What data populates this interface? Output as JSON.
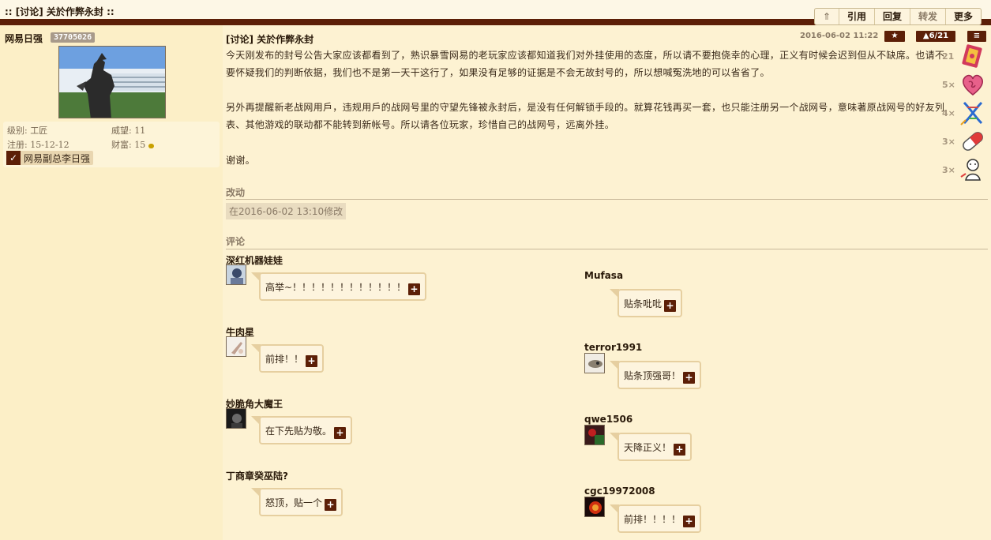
{
  "window": {
    "title": ":: [讨论] 关於作弊永封 ::"
  },
  "toolbar": {
    "top_label": "⇑",
    "quote_label": "引用",
    "reply_label": "回复",
    "forward_label": "转发",
    "more_label": "更多"
  },
  "author": {
    "name": "网易日强",
    "uid": "37705026",
    "level_label": "级别: 工匠",
    "prestige_label": "威望: 11",
    "registered_label": "注册: 15-12-12",
    "wealth_label": "财富: 15",
    "badge_title": "网易副总李日强"
  },
  "post": {
    "title": "[讨论] 关於作弊永封",
    "date": "2016-06-02 11:22",
    "star_label": "★",
    "vote_label": "▲6/21",
    "menu_label": "≡",
    "paragraphs": [
      "今天刚发布的封号公告大家应该都看到了，熟识暴雪网易的老玩家应该都知道我们对外挂使用的态度，所以请不要抱侥幸的心理，正义有时候会迟到但从不缺席。也请不要怀疑我们的判断依据，我们也不是第一天干这行了，如果没有足够的证据是不会无故封号的，所以想喊冤洗地的可以省省了。",
      "另外再提醒新老战网用戶，违规用戶的战网号里的守望先锋被永封后，是没有任何解锁手段的。就算花钱再买一套，也只能注册另一个战网号，意味著原战网号的好友列表、其他游戏的联动都不能转到新帐号。所以请各位玩家，珍惜自己的战网号，远离外挂。",
      "谢谢。"
    ],
    "edit_section_label": "改动",
    "edit_note": "在2016-06-02 13:10修改",
    "comments_section_label": "评论"
  },
  "rewards": [
    {
      "count": "21",
      "icon": "card-reward-icon"
    },
    {
      "count": "5×",
      "icon": "heart-reward-icon"
    },
    {
      "count": "4×",
      "icon": "dna-reward-icon"
    },
    {
      "count": "3×",
      "icon": "pill-reward-icon"
    },
    {
      "count": "3×",
      "icon": "character-reward-icon"
    }
  ],
  "comments": [
    {
      "user": "深红机器娃娃",
      "text": "高举~！！！！！！！！！！！！"
    },
    {
      "user": "Mufasa",
      "text": "贴条吡吡"
    },
    {
      "user": "牛肉星",
      "text": "前排！！"
    },
    {
      "user": "terror1991",
      "text": "贴条顶强哥！"
    },
    {
      "user": "妙脆角大魔王",
      "text": "在下先贴为敬。"
    },
    {
      "user": "qwe1506",
      "text": "天降正义！"
    },
    {
      "user": "丁商章癸巫陆?",
      "text": "怒顶，贴一个"
    },
    {
      "user": "cgc19972008",
      "text": "前排！！！！"
    }
  ],
  "comment_action_label": "+"
}
